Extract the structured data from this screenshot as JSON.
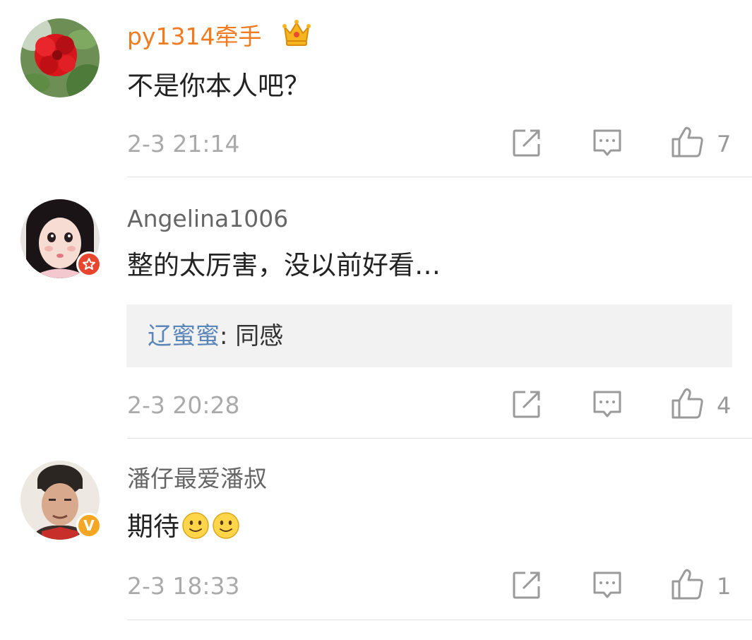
{
  "colors": {
    "vip_username": "#f07b21",
    "normal_username": "#666666",
    "reply_name": "#5b87b8",
    "timestamp": "#aaaaaa",
    "icon_gray": "#9a9a9a"
  },
  "comments": [
    {
      "username": "py1314牵手",
      "username_style": "vip",
      "crown_icon": "crown-icon",
      "text": "不是你本人吧？",
      "timestamp": "2-3 21:14",
      "like_count": "7"
    },
    {
      "username": "Angelina1006",
      "username_style": "normal",
      "badge": "star-badge-icon",
      "text": "整的太厉害，没以前好看…",
      "reply": {
        "name": "辽蜜蜜",
        "separator": ": ",
        "text": "同感"
      },
      "timestamp": "2-3 20:28",
      "like_count": "4"
    },
    {
      "username": "潘仔最爱潘叔",
      "username_style": "normal",
      "badge": "verified-v-badge-icon",
      "badge_letter": "V",
      "text": "期待",
      "emoji": [
        "smile-emoji-icon",
        "smile-emoji-icon"
      ],
      "timestamp": "2-3 18:33",
      "like_count": "1"
    }
  ]
}
